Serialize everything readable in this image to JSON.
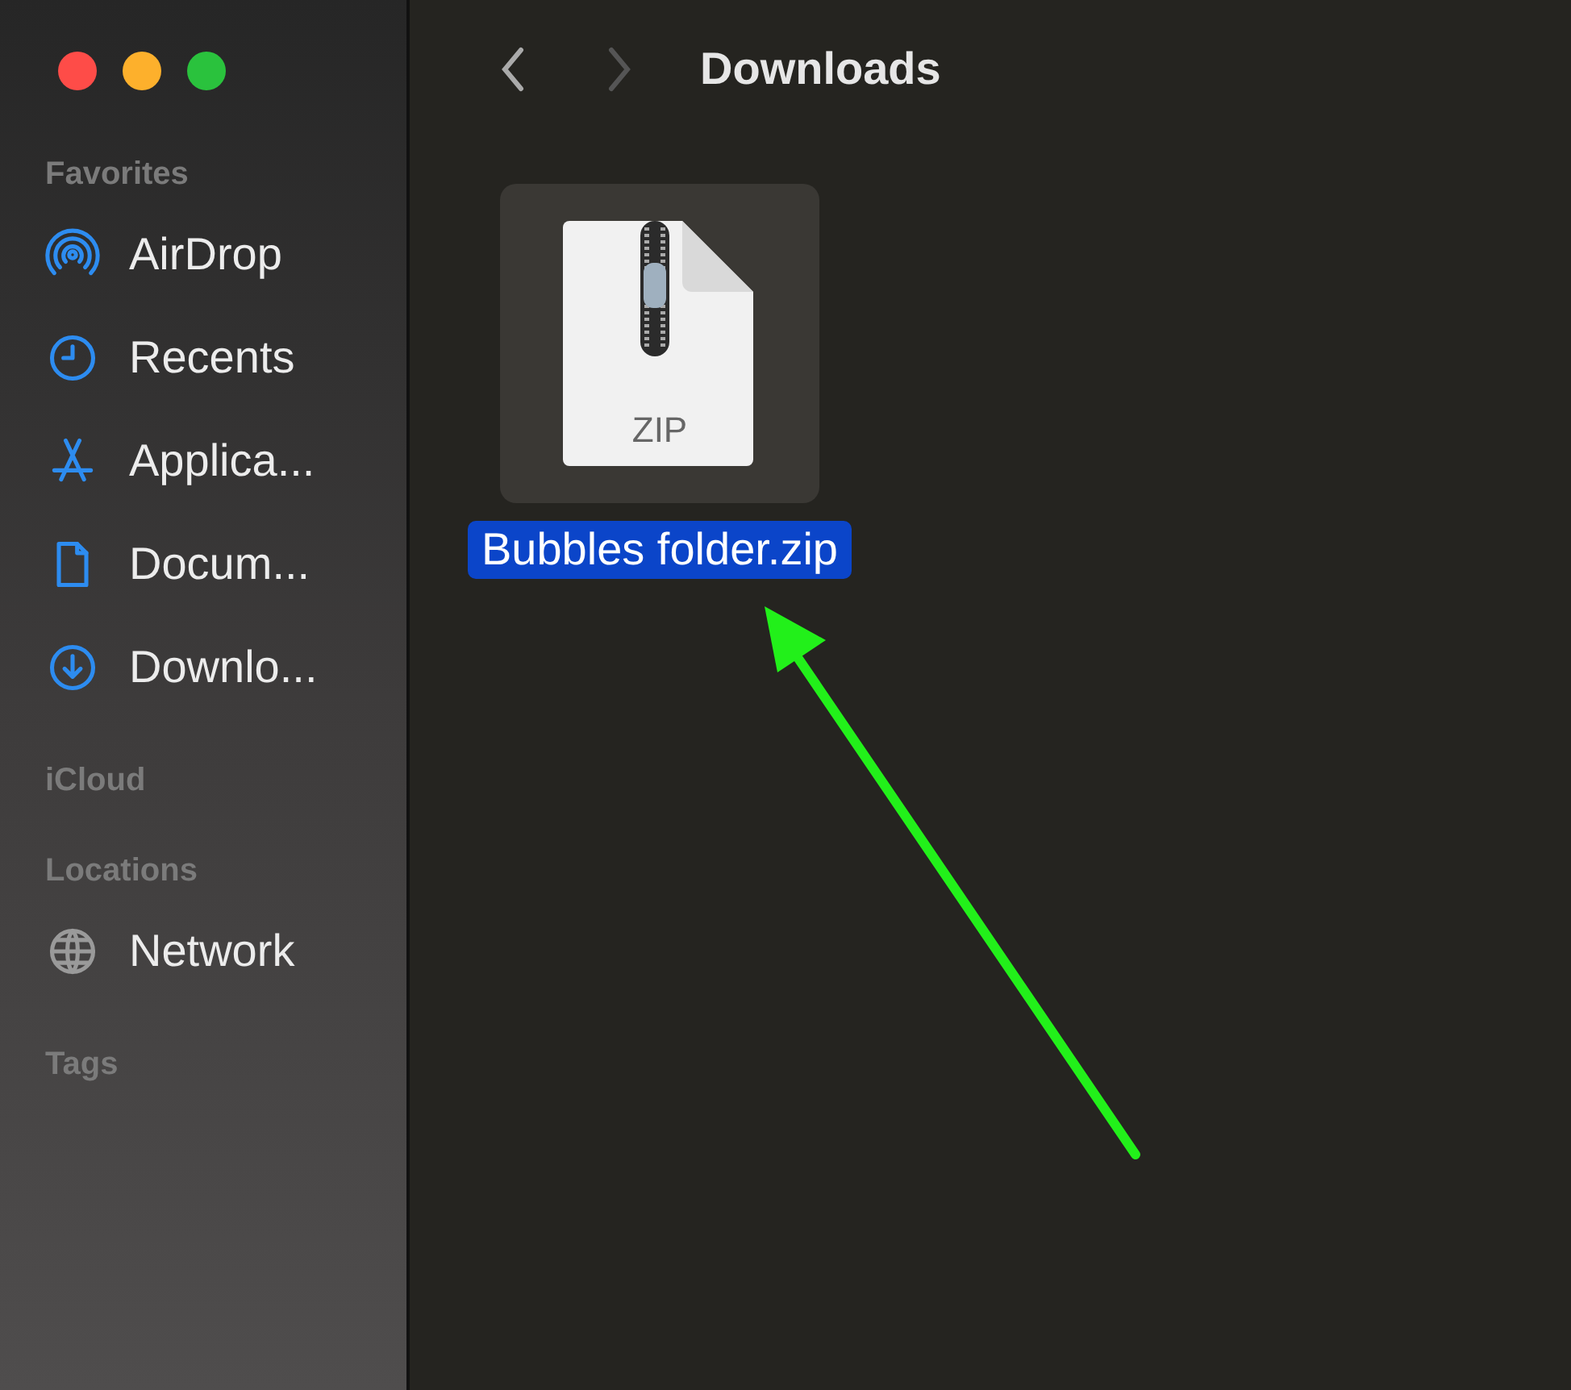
{
  "window": {
    "title": "Downloads"
  },
  "navigation": {
    "back": {
      "disabled": false
    },
    "forward": {
      "disabled": true
    }
  },
  "sidebar": {
    "sections": [
      {
        "title": "Favorites",
        "items": [
          {
            "label": "AirDrop",
            "kind": "airdrop"
          },
          {
            "label": "Recents",
            "kind": "clock"
          },
          {
            "label": "Applica...",
            "kind": "apps"
          },
          {
            "label": "Docum...",
            "kind": "document"
          },
          {
            "label": "Downlo...",
            "kind": "download"
          }
        ]
      },
      {
        "title": "iCloud"
      },
      {
        "title": "Locations",
        "items": [
          {
            "label": "Network",
            "kind": "globe"
          }
        ]
      },
      {
        "title": "Tags"
      }
    ]
  },
  "files": [
    {
      "name": "Bubbles folder.zip",
      "badge": "ZIP",
      "selected": true
    }
  ],
  "annotations": [
    {
      "kind": "arrow"
    }
  ]
}
